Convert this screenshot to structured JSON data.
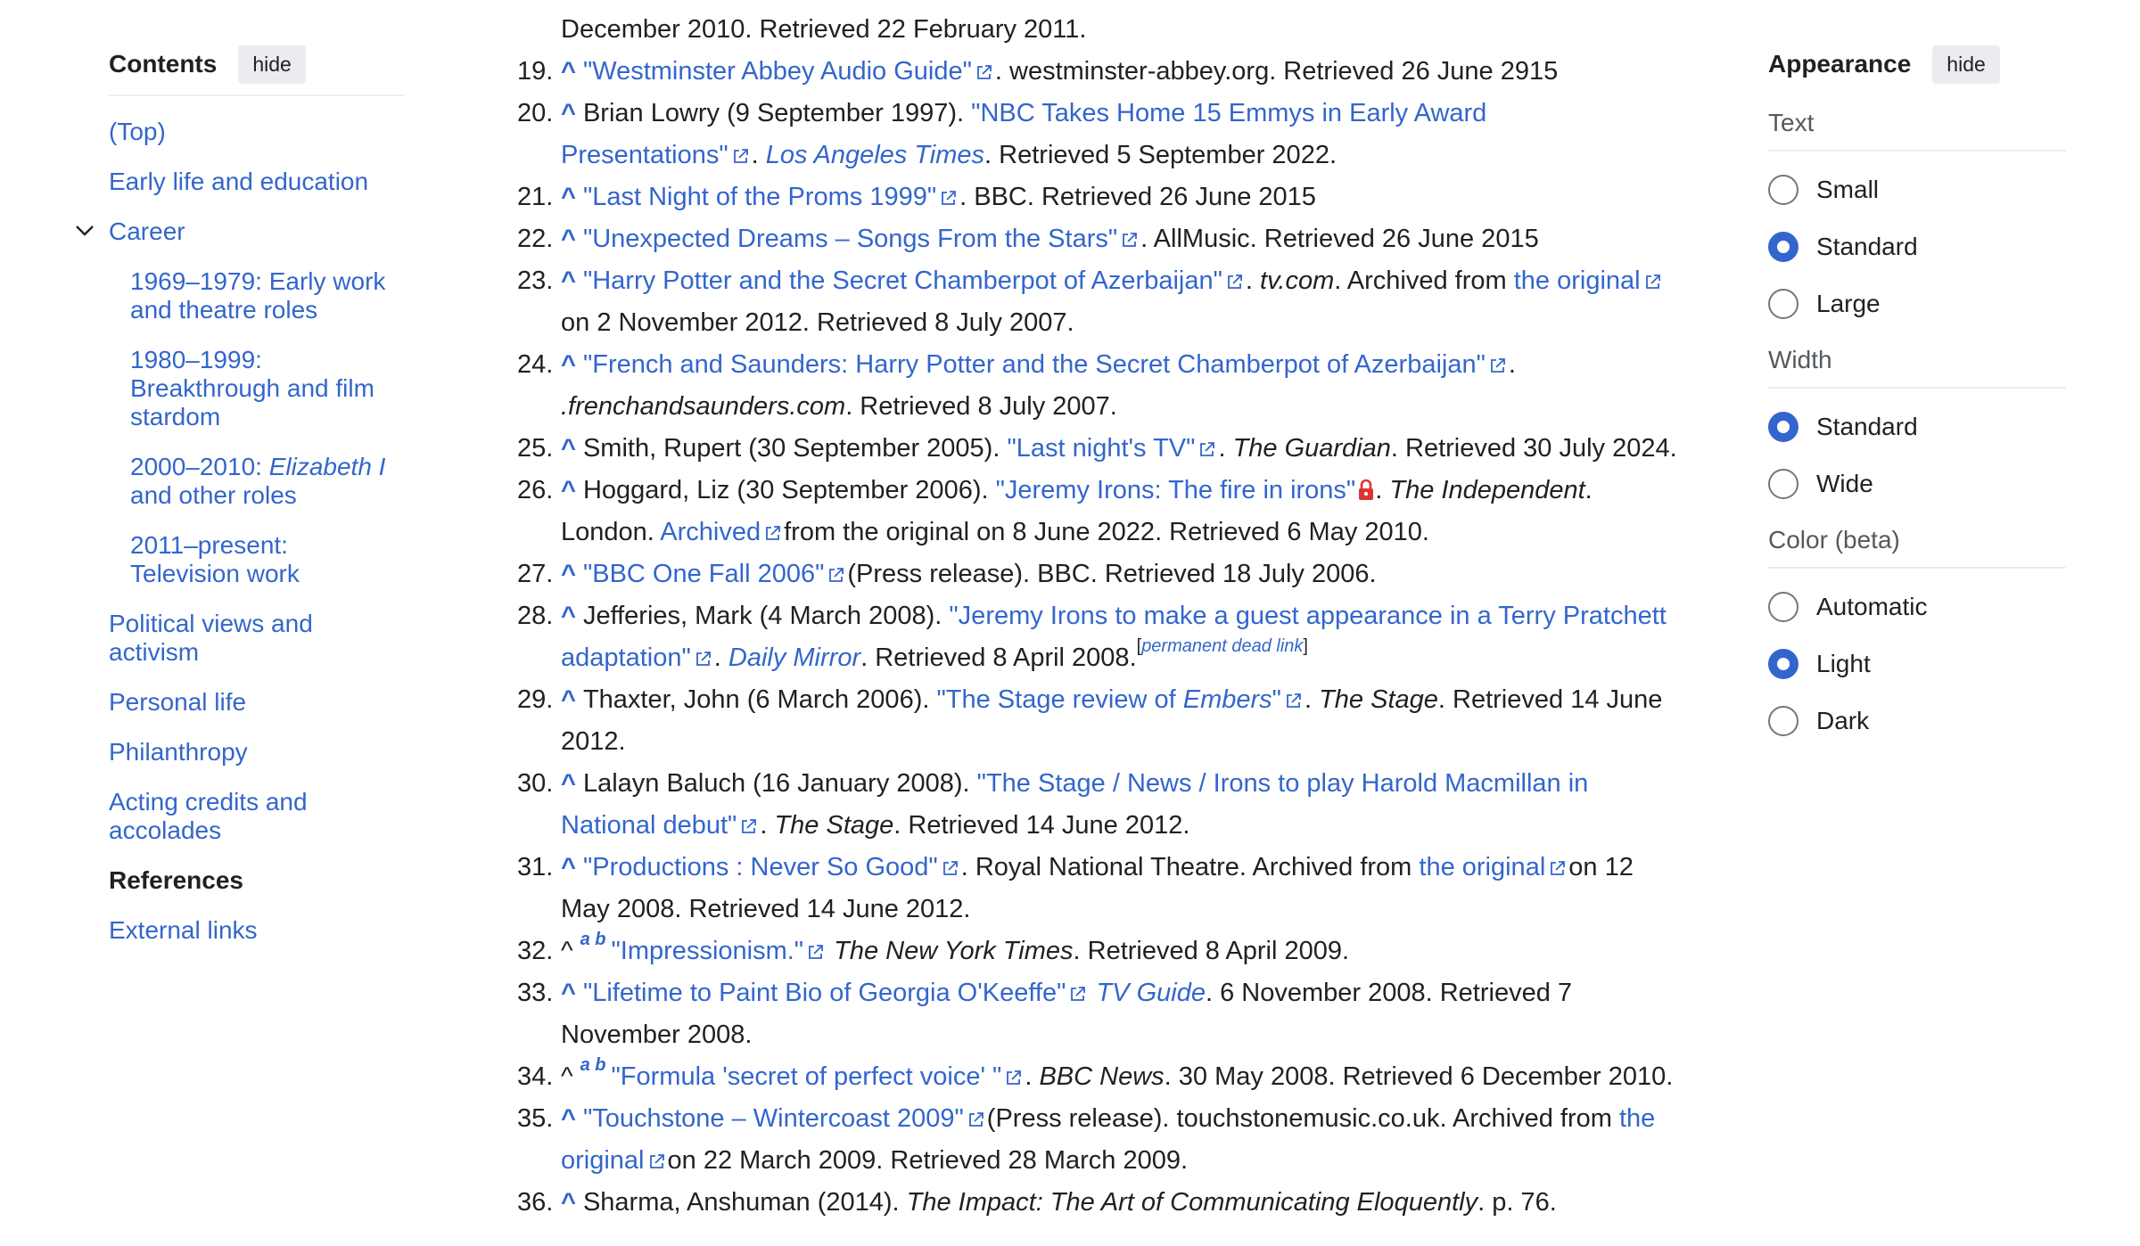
{
  "toc": {
    "title": "Contents",
    "hide_label": "hide",
    "items": [
      {
        "label": "(Top)"
      },
      {
        "label": "Early life and education"
      },
      {
        "label": "Career"
      },
      {
        "label_a": "1969–1979: Early work",
        "label_b": "and theatre roles"
      },
      {
        "label_a": "1980–1999:",
        "label_b": "Breakthrough and film",
        "label_c": "stardom"
      },
      {
        "label_a": "2000–2010: ",
        "label_i": "Elizabeth I",
        "label_b": "and other roles"
      },
      {
        "label_a": "2011–present:",
        "label_b": "Television work"
      },
      {
        "label_a": "Political views and",
        "label_b": "activism"
      },
      {
        "label": "Personal life"
      },
      {
        "label": "Philanthropy"
      },
      {
        "label_a": "Acting credits and",
        "label_b": "accolades"
      },
      {
        "label": "References"
      },
      {
        "label": "External links"
      }
    ]
  },
  "appearance": {
    "title": "Appearance",
    "hide_label": "hide",
    "text_label": "Text",
    "text_options": [
      "Small",
      "Standard",
      "Large"
    ],
    "text_selected": "Standard",
    "width_label": "Width",
    "width_options": [
      "Standard",
      "Wide"
    ],
    "width_selected": "Standard",
    "color_label": "Color (beta)",
    "color_options": [
      "Automatic",
      "Light",
      "Dark"
    ],
    "color_selected": "Light",
    "accent": "#3366cc"
  },
  "refs": {
    "top_line": "December 2010. Retrieved 22 February 2011.",
    "r19": {
      "num": "19.",
      "caret": "^",
      "link": "\"Westminster Abbey Audio Guide\"",
      "rest": ". westminster-abbey.org. Retrieved 26 June 2915"
    },
    "r20": {
      "num": "20.",
      "caret": "^",
      "pre": "Brian Lowry (9 September 1997). ",
      "link1": "\"NBC Takes Home 15 Emmys in Early Award",
      "link2": "Presentations\"",
      "dot": ". ",
      "pub": "Los Angeles Times",
      "rest": ". Retrieved 5 September 2022."
    },
    "r21": {
      "num": "21.",
      "caret": "^",
      "link": "\"Last Night of the Proms 1999\"",
      "rest": ". BBC. Retrieved 26 June 2015"
    },
    "r22": {
      "num": "22.",
      "caret": "^",
      "link": "\"Unexpected Dreams – Songs From the Stars\"",
      "rest": ". AllMusic. Retrieved 26 June 2015"
    },
    "r23": {
      "num": "23.",
      "caret": "^",
      "link": "\"Harry Potter and the Secret Chamberpot of Azerbaijan\"",
      "dot": ". ",
      "pub": "tv.com",
      "mid": ". Archived from ",
      "link2": "the original",
      "rest": "on 2 November 2012. Retrieved 8 July 2007."
    },
    "r24": {
      "num": "24.",
      "caret": "^",
      "link": "\"French and Saunders: Harry Potter and the Secret Chamberpot of Azerbaijan\"",
      "dot": ".",
      "pub": ".frenchandsaunders.com",
      "rest": ". Retrieved 8 July 2007."
    },
    "r25": {
      "num": "25.",
      "caret": "^",
      "pre": "Smith, Rupert (30 September 2005). ",
      "link": "\"Last night's TV\"",
      "dot": ". ",
      "pub": "The Guardian",
      "rest": ". Retrieved 30 July 2024."
    },
    "r26": {
      "num": "26.",
      "caret": "^",
      "pre": "Hoggard, Liz (30 September 2006). ",
      "link": "\"Jeremy Irons: The fire in irons\"",
      "dot": ". ",
      "pub": "The Independent",
      "mid": ".",
      "pre2": "London. ",
      "link2": "Archived",
      "rest": "from the original on 8 June 2022. Retrieved 6 May 2010."
    },
    "r27": {
      "num": "27.",
      "caret": "^",
      "link": "\"BBC One Fall 2006\"",
      "rest": "(Press release). BBC. Retrieved 18 July 2006."
    },
    "r28": {
      "num": "28.",
      "caret": "^",
      "pre": "Jefferies, Mark (4 March 2008). ",
      "link1": "\"Jeremy Irons to make a guest appearance in a Terry Pratchett",
      "link2": "adaptation\"",
      "dot": ". ",
      "pub": "Daily Mirror",
      "rest": ". Retrieved 8 April 2008.",
      "dead_open": "[",
      "dead_link": "permanent dead link",
      "dead_close": "]"
    },
    "r29": {
      "num": "29.",
      "caret": "^",
      "pre": "Thaxter, John (6 March 2006). ",
      "link_a": "\"The Stage review of ",
      "link_i": "Embers",
      "link_b": "\"",
      "dot": ". ",
      "pub": "The Stage",
      "rest": ". Retrieved 14 June",
      "rest2": "2012."
    },
    "r30": {
      "num": "30.",
      "caret": "^",
      "pre": "Lalayn Baluch (16 January 2008). ",
      "link1": "\"The Stage / News / Irons to play Harold Macmillan in",
      "link2": "National debut\"",
      "dot": ". ",
      "pub": "The Stage",
      "rest": ". Retrieved 14 June 2012."
    },
    "r31": {
      "num": "31.",
      "caret": "^",
      "link": "\"Productions : Never So Good\"",
      "mid": ". Royal National Theatre. Archived from ",
      "link2": "the original",
      "rest": "on 12",
      "rest2": "May 2008. Retrieved 14 June 2012."
    },
    "r32": {
      "num": "32.",
      "caret": "^",
      "a": "a",
      "b": "b",
      "link": "\"Impressionism.\"",
      "pub": "The New York Times",
      "rest": ". Retrieved 8 April 2009."
    },
    "r33": {
      "num": "33.",
      "caret": "^",
      "link": "\"Lifetime to Paint Bio of Georgia O'Keeffe\"",
      "pub": "TV Guide",
      "rest": ". 6 November 2008. Retrieved 7",
      "rest2": "November 2008."
    },
    "r34": {
      "num": "34.",
      "caret": "^",
      "a": "a",
      "b": "b",
      "link": "\"Formula 'secret of perfect voice' \"",
      "dot": ". ",
      "pub": "BBC News",
      "rest": ". 30 May 2008. Retrieved 6 December 2010."
    },
    "r35": {
      "num": "35.",
      "caret": "^",
      "link": "\"Touchstone – Wintercoast 2009\"",
      "mid": "(Press release). touchstonemusic.co.uk. Archived from ",
      "link2a": "the",
      "link2b": "original",
      "rest": "on 22 March 2009. Retrieved 28 March 2009."
    },
    "r36": {
      "num": "36.",
      "caret": "^",
      "pre": "Sharma, Anshuman (2014). ",
      "pub": "The Impact: The Art of Communicating Eloquently",
      "rest": ". p. 76."
    }
  }
}
